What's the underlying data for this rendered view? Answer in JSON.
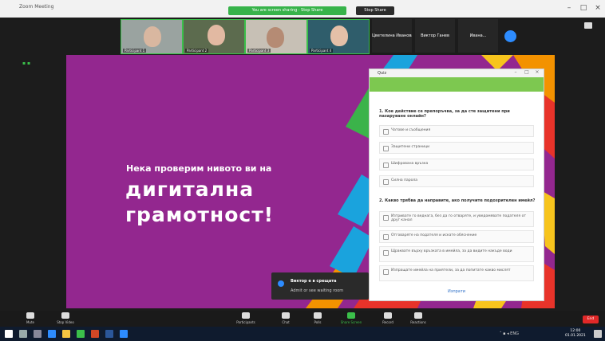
{
  "window": {
    "title": "Zoom Meeting",
    "share_banner": "You are screen sharing · Stop Share",
    "stop_share_label": "Stop Share"
  },
  "participants": [
    {
      "name": "Participant 1"
    },
    {
      "name": "Participant 2"
    },
    {
      "name": "Participant 3"
    },
    {
      "name": "Participant 4"
    }
  ],
  "name_tiles": [
    "Цветелина Иванова",
    "Виктор Ганев",
    "Ивана..."
  ],
  "slide": {
    "line1": "Нека проверим нивото ви на",
    "line2": "дигитална",
    "line3": "грамотност!",
    "colors": {
      "background": "#93278f"
    }
  },
  "form": {
    "title": "Quiz",
    "question1": "1. Кое действие се препоръчва, за да сте защитени при пазаруване онлайн?",
    "q1_options": [
      "Чатове и съобщения",
      "Защитени страници",
      "Шифрована връзка",
      "Силна парола"
    ],
    "question2": "2. Какво трябва да направите, ако получите подозрителен имейл?",
    "q2_options": [
      "Изтривате го веднага, без да го отваряте, и уведомявате подателя от друг канал",
      "Отговаряте на подателя и искате обяснение",
      "Щраквате върху връзката в имейла, за да видите накъде води",
      "Изпращате имейла на приятели, за да попитате какво мислят"
    ],
    "link_label": "Изпрати"
  },
  "toast": {
    "title": "Виктор е в срещата",
    "subtitle": "Admit or see waiting room"
  },
  "toolbar": {
    "mute": "Mute",
    "video": "Stop Video",
    "participants": "Participants",
    "chat": "Chat",
    "polls": "Polls",
    "share": "Share Screen",
    "record": "Record",
    "reactions": "Reactions",
    "end": "End"
  },
  "taskbar": {
    "time": "12:00",
    "date": "01.01.2021"
  }
}
